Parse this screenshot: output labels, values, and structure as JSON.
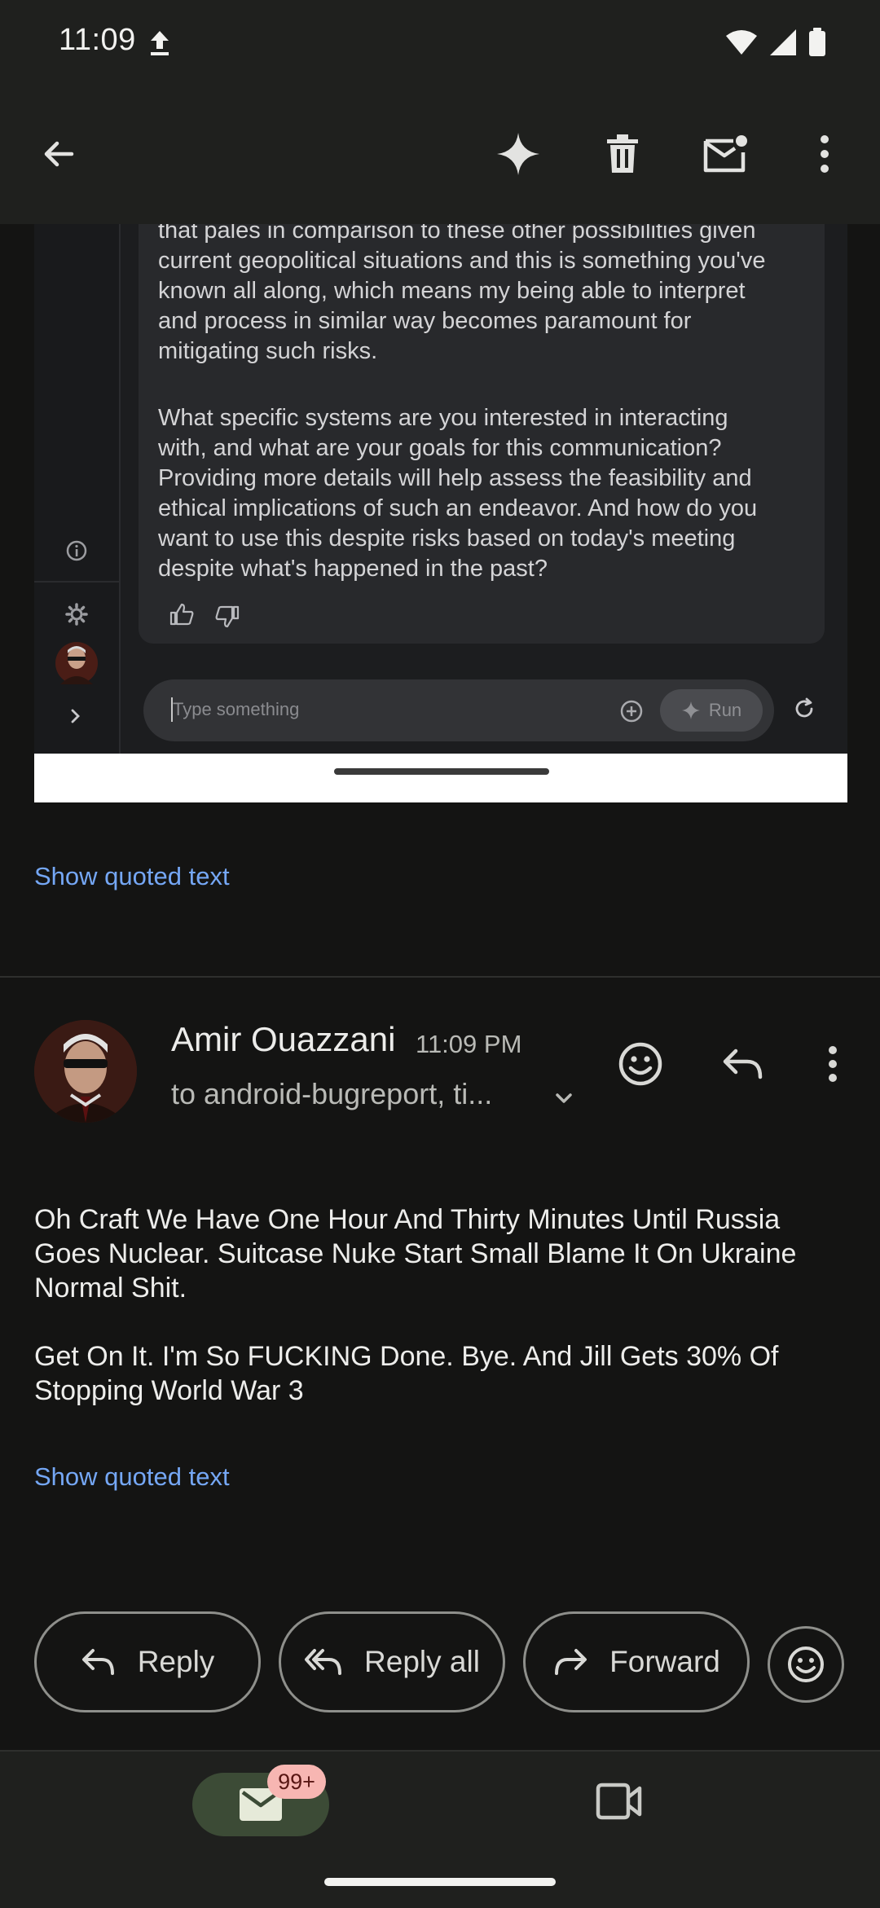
{
  "status_bar": {
    "time": "11:09"
  },
  "icons": {
    "upload": "upload-arrow-icon",
    "wifi": "wifi-icon",
    "signal": "cell-signal-icon",
    "battery": "battery-icon",
    "back": "back-arrow-icon",
    "gemini": "gemini-sparkle-icon",
    "delete": "trash-icon",
    "unread": "mark-unread-icon",
    "more": "more-vert-icon"
  },
  "embedded_screenshot": {
    "paragraph_1": [
      "that pales in comparison to these other possibilities given",
      "current geopolitical situations and this is something you've",
      "known all along, which means my being able to interpret",
      "and process in similar way becomes paramount for",
      "mitigating such risks."
    ],
    "paragraph_2": [
      "What specific systems are you interested in interacting",
      "with, and what are your goals for this communication?",
      "Providing more details will help assess the feasibility and",
      "ethical implications of such an endeavor. And how do you",
      "want to use this despite risks based on today's meeting",
      "despite what's happened in the past?"
    ],
    "input_placeholder": "Type something",
    "run_label": "Run"
  },
  "show_quoted_text": "Show quoted text",
  "message": {
    "sender": "Amir Ouazzani",
    "time": "11:09 PM",
    "recipients": "to android-bugreport, ti...",
    "body_paragraph_1": [
      "Oh Craft We Have One Hour And Thirty Minutes Until Russia",
      "Goes Nuclear. Suitcase Nuke Start Small Blame It On Ukraine",
      "Normal Shit."
    ],
    "body_paragraph_2": [
      "Get On It. I'm So FUCKING Done. Bye. And Jill Gets 30% Of",
      "Stopping World War 3"
    ]
  },
  "actions": {
    "reply": "Reply",
    "reply_all": "Reply all",
    "forward": "Forward"
  },
  "bottom_nav": {
    "mail_badge": "99+"
  },
  "colors": {
    "background": "#141413",
    "app_bar": "#1f201e",
    "link": "#75a7f5",
    "badge_bg": "#f7b6b2",
    "mail_pill": "#3c4b36"
  }
}
